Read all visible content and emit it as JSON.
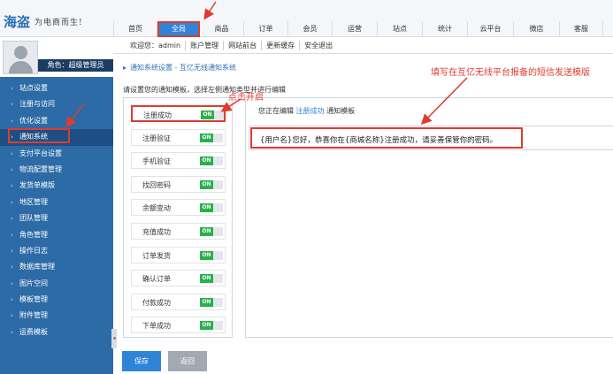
{
  "header": {
    "logo": "海盗",
    "logo_sub": "为电商而生!",
    "nav": [
      {
        "label": "首页",
        "w": 50
      },
      {
        "label": "全局",
        "w": 48,
        "active": true
      },
      {
        "label": "商品",
        "w": 50
      },
      {
        "label": "订单",
        "w": 50
      },
      {
        "label": "会员",
        "w": 50
      },
      {
        "label": "运营",
        "w": 51
      },
      {
        "label": "站点",
        "w": 51
      },
      {
        "label": "统计",
        "w": 51
      },
      {
        "label": "云平台",
        "w": 52
      },
      {
        "label": "微店",
        "w": 52
      },
      {
        "label": "客服",
        "w": 49
      }
    ]
  },
  "subbar": {
    "welcome": "欢迎您：admin",
    "links": [
      "账户管理",
      "网站前台",
      "更新缓存",
      "安全退出"
    ]
  },
  "sidebar": {
    "role": "角色：超级管理员",
    "items": [
      "站点设置",
      "注册与访问",
      "优化设置",
      "通知系统",
      "支付平台设置",
      "物流配置管理",
      "发货单模版",
      "地区管理",
      "团队管理",
      "角色管理",
      "操作日志",
      "数据库管理",
      "图片空间",
      "模板管理",
      "附件管理",
      "运费模板"
    ],
    "active_index": 3,
    "collapse_glyph": "◂"
  },
  "breadcrumb": "通知系统设置 - 互亿无线通知系统",
  "instruction": "请设置您的通知模板，选择左侧通知类型并进行编辑",
  "templates": [
    {
      "name": "注册成功",
      "status": "ON"
    },
    {
      "name": "注册验证",
      "status": "ON"
    },
    {
      "name": "手机验证",
      "status": "ON"
    },
    {
      "name": "找回密码",
      "status": "ON"
    },
    {
      "name": "余额变动",
      "status": "ON"
    },
    {
      "name": "充值成功",
      "status": "ON"
    },
    {
      "name": "订单发货",
      "status": "ON"
    },
    {
      "name": "确认订单",
      "status": "ON"
    },
    {
      "name": "付款成功",
      "status": "ON"
    },
    {
      "name": "下单成功",
      "status": "ON"
    }
  ],
  "editor": {
    "prefix": "您正在编辑",
    "template_name": "注册成功",
    "suffix": "通知模板",
    "content": "{用户名}您好，恭喜你在{商城名称}注册成功，请妥善保管你的密码。"
  },
  "buttons": {
    "save": "保存",
    "back": "返回"
  },
  "annotations": {
    "toggle_hint": "点击开启",
    "content_hint": "填写在互亿无线平台报备的短信发送模版"
  },
  "colors": {
    "primary": "#2f84d8",
    "sidebar": "#2d6ba6",
    "toggle_on": "#27b24a",
    "annotation": "#e03a2f"
  }
}
